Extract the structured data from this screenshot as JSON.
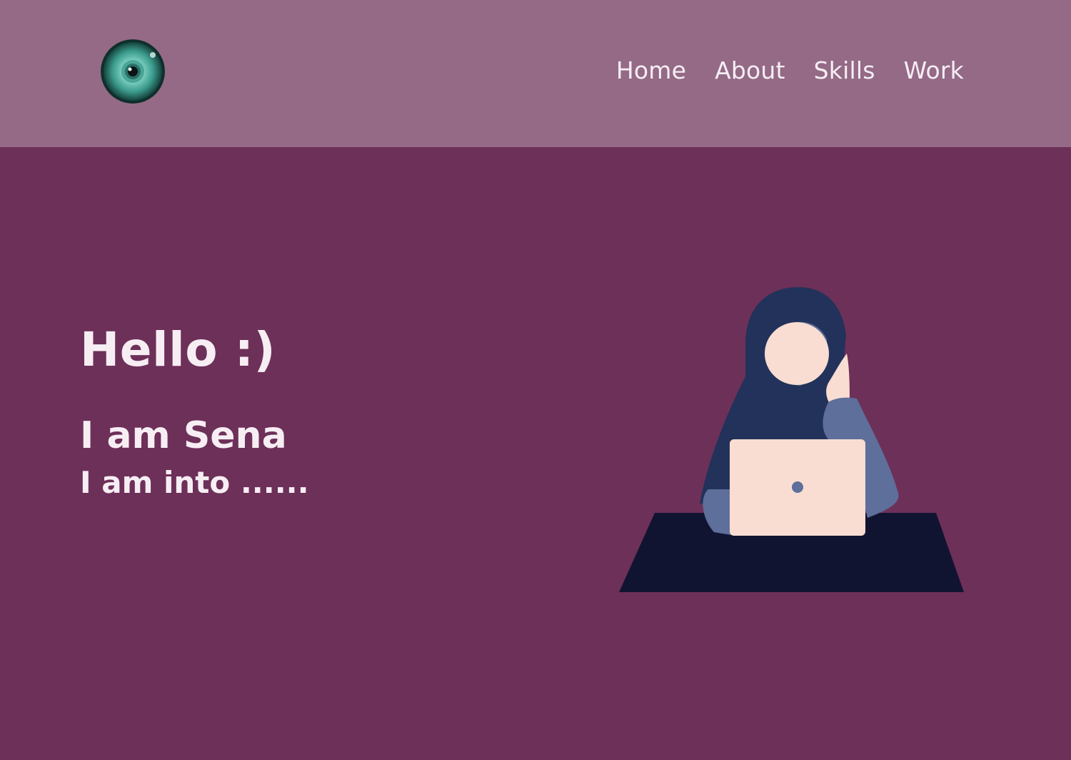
{
  "header": {
    "logo_icon": "eye-logo-icon",
    "nav": [
      "Home",
      "About",
      "Skills",
      "Work"
    ]
  },
  "hero": {
    "greeting": "Hello :)",
    "name_line": "I am Sena",
    "interests_line": "I am into ......",
    "illustration": "woman-in-hijab-with-laptop-illustration"
  },
  "colors": {
    "header_bg": "#946a86",
    "page_bg": "#6d3059",
    "text": "#f7eef4",
    "hijab": "#22325a",
    "sleeve": "#5d6f9a",
    "skin": "#f9ddd2",
    "desk": "#111430"
  }
}
